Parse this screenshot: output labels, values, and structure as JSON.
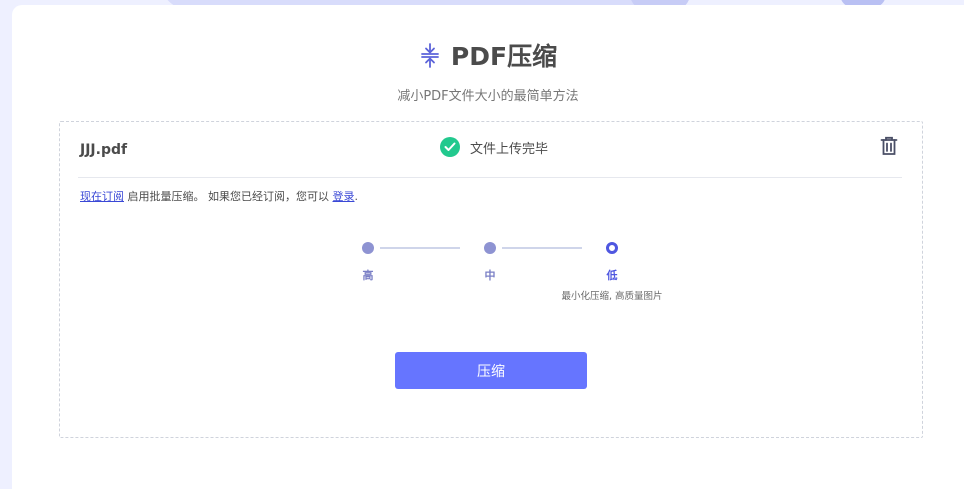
{
  "header": {
    "icon": "compress-icon",
    "title": "PDF压缩",
    "subtitle": "减小PDF文件大小的最简单方法"
  },
  "file": {
    "name": "JJJ.pdf",
    "status_icon": "check-circle-icon",
    "status_text": "文件上传完毕",
    "delete_icon": "trash-icon"
  },
  "notice": {
    "subscribe_link": "现在订阅",
    "text_1": "启用批量压缩。 如果您已经订阅，您可以",
    "login_link": "登录",
    "text_2": "."
  },
  "levels": {
    "items": [
      {
        "label": "高"
      },
      {
        "label": "中"
      },
      {
        "label": "低"
      }
    ],
    "selected": "低",
    "selected_description": "最小化压缩, 高质量图片"
  },
  "action": {
    "compress_label": "压缩"
  },
  "colors": {
    "accent": "#6675ff",
    "selected_level": "#4f57e0",
    "success": "#22c98e",
    "background": "#eef0ff"
  }
}
